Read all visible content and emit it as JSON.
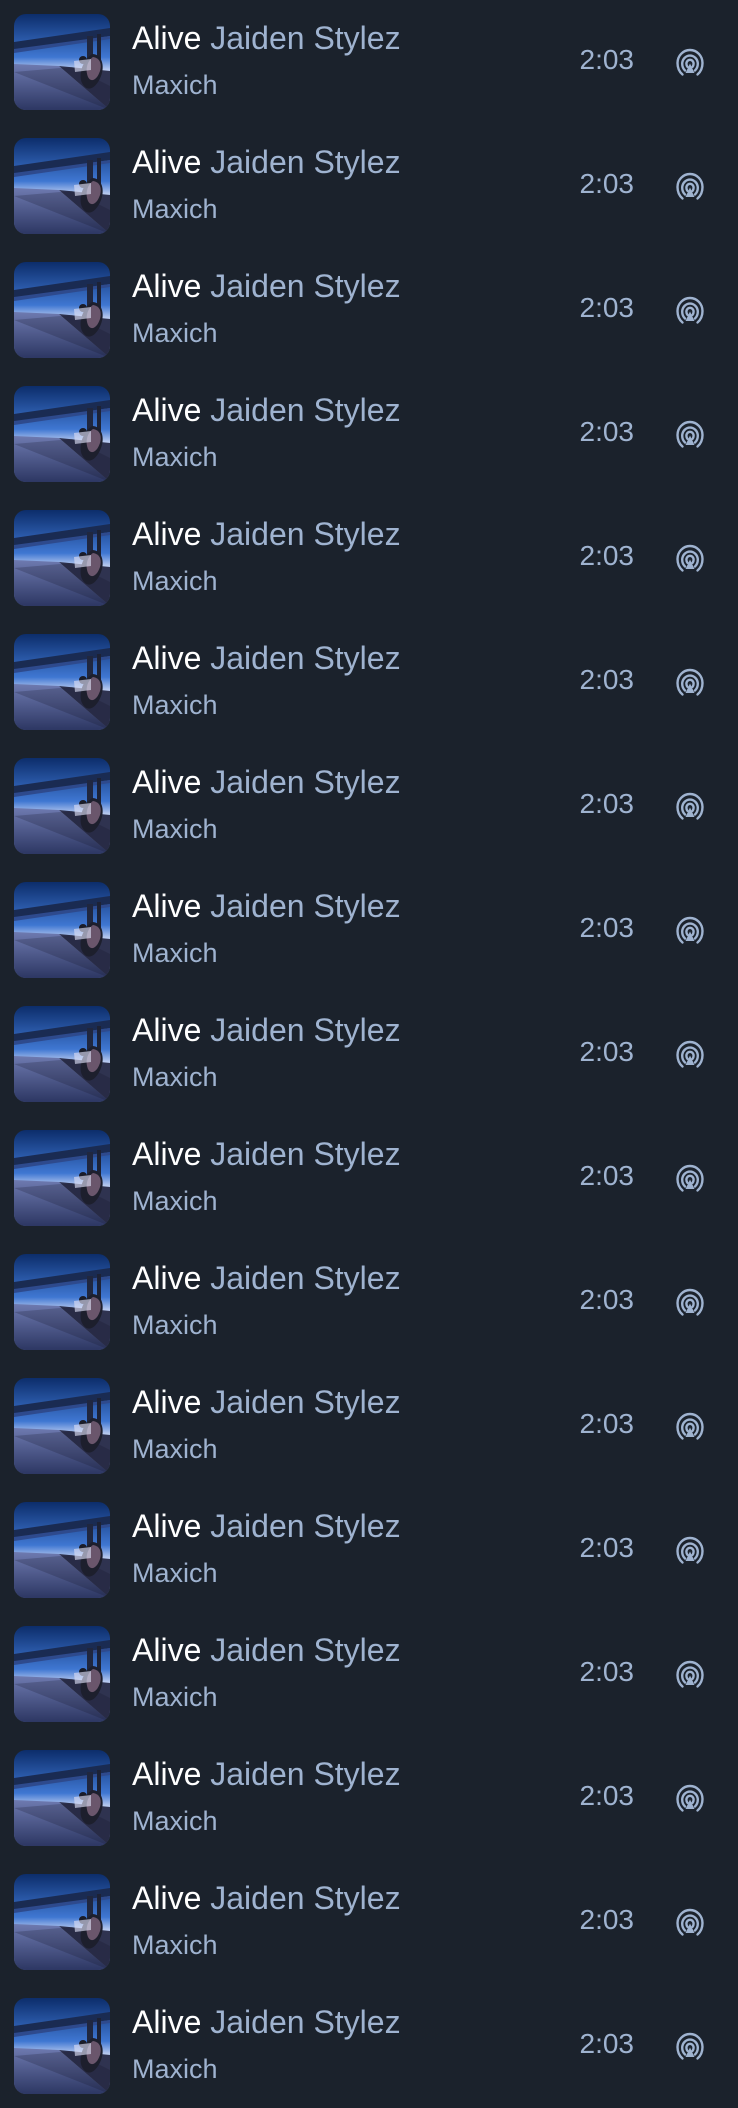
{
  "colors": {
    "background": "#1b222c",
    "title": "#ffffff",
    "secondary": "#9fb3d0"
  },
  "tracks": [
    {
      "title": "Alive",
      "artist": "Jaiden Stylez",
      "subartist": "Maxich",
      "duration": "2:03",
      "cover_icon": "album-cover-road",
      "action_icon": "broadcast-icon"
    },
    {
      "title": "Alive",
      "artist": "Jaiden Stylez",
      "subartist": "Maxich",
      "duration": "2:03",
      "cover_icon": "album-cover-road",
      "action_icon": "broadcast-icon"
    },
    {
      "title": "Alive",
      "artist": "Jaiden Stylez",
      "subartist": "Maxich",
      "duration": "2:03",
      "cover_icon": "album-cover-road",
      "action_icon": "broadcast-icon"
    },
    {
      "title": "Alive",
      "artist": "Jaiden Stylez",
      "subartist": "Maxich",
      "duration": "2:03",
      "cover_icon": "album-cover-road",
      "action_icon": "broadcast-icon"
    },
    {
      "title": "Alive",
      "artist": "Jaiden Stylez",
      "subartist": "Maxich",
      "duration": "2:03",
      "cover_icon": "album-cover-road",
      "action_icon": "broadcast-icon"
    },
    {
      "title": "Alive",
      "artist": "Jaiden Stylez",
      "subartist": "Maxich",
      "duration": "2:03",
      "cover_icon": "album-cover-road",
      "action_icon": "broadcast-icon"
    },
    {
      "title": "Alive",
      "artist": "Jaiden Stylez",
      "subartist": "Maxich",
      "duration": "2:03",
      "cover_icon": "album-cover-road",
      "action_icon": "broadcast-icon"
    },
    {
      "title": "Alive",
      "artist": "Jaiden Stylez",
      "subartist": "Maxich",
      "duration": "2:03",
      "cover_icon": "album-cover-road",
      "action_icon": "broadcast-icon"
    },
    {
      "title": "Alive",
      "artist": "Jaiden Stylez",
      "subartist": "Maxich",
      "duration": "2:03",
      "cover_icon": "album-cover-road",
      "action_icon": "broadcast-icon"
    },
    {
      "title": "Alive",
      "artist": "Jaiden Stylez",
      "subartist": "Maxich",
      "duration": "2:03",
      "cover_icon": "album-cover-road",
      "action_icon": "broadcast-icon"
    },
    {
      "title": "Alive",
      "artist": "Jaiden Stylez",
      "subartist": "Maxich",
      "duration": "2:03",
      "cover_icon": "album-cover-road",
      "action_icon": "broadcast-icon"
    },
    {
      "title": "Alive",
      "artist": "Jaiden Stylez",
      "subartist": "Maxich",
      "duration": "2:03",
      "cover_icon": "album-cover-road",
      "action_icon": "broadcast-icon"
    },
    {
      "title": "Alive",
      "artist": "Jaiden Stylez",
      "subartist": "Maxich",
      "duration": "2:03",
      "cover_icon": "album-cover-road",
      "action_icon": "broadcast-icon"
    },
    {
      "title": "Alive",
      "artist": "Jaiden Stylez",
      "subartist": "Maxich",
      "duration": "2:03",
      "cover_icon": "album-cover-road",
      "action_icon": "broadcast-icon"
    },
    {
      "title": "Alive",
      "artist": "Jaiden Stylez",
      "subartist": "Maxich",
      "duration": "2:03",
      "cover_icon": "album-cover-road",
      "action_icon": "broadcast-icon"
    },
    {
      "title": "Alive",
      "artist": "Jaiden Stylez",
      "subartist": "Maxich",
      "duration": "2:03",
      "cover_icon": "album-cover-road",
      "action_icon": "broadcast-icon"
    },
    {
      "title": "Alive",
      "artist": "Jaiden Stylez",
      "subartist": "Maxich",
      "duration": "2:03",
      "cover_icon": "album-cover-road",
      "action_icon": "broadcast-icon"
    }
  ]
}
